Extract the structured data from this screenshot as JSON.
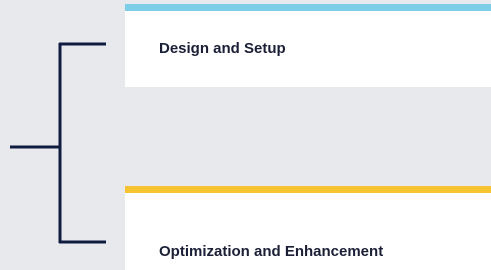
{
  "colors": {
    "background": "#e8e9ed",
    "card": "#ffffff",
    "bracket": "#0f1c3f",
    "top_accent": "#7ecde8",
    "bottom_accent": "#f7c431",
    "text": "#1a1f36"
  },
  "items": [
    {
      "label": "Design and Setup",
      "accent": "top_accent"
    },
    {
      "label": "Optimization and Enhancement",
      "accent": "bottom_accent"
    }
  ]
}
